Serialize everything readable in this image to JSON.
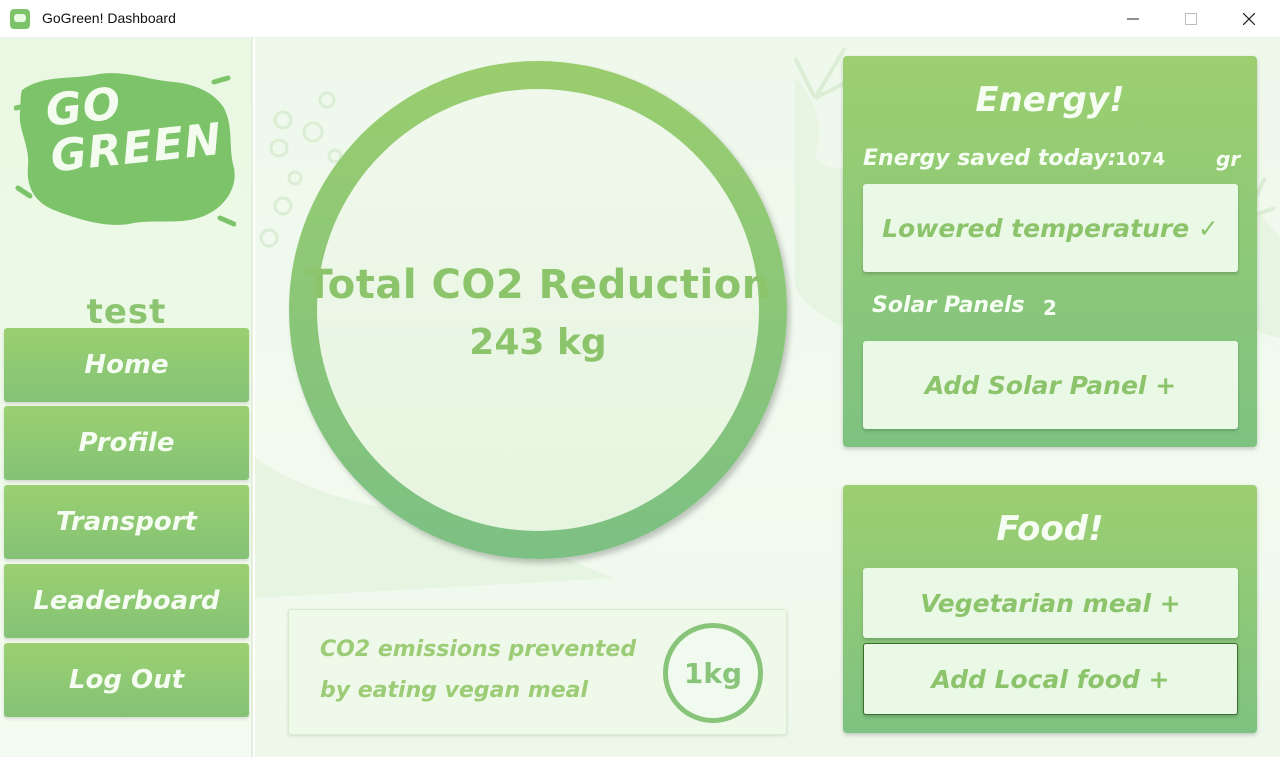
{
  "window": {
    "title": "GoGreen! Dashboard",
    "controls": {
      "minimize": "minimize-icon",
      "maximize": "maximize-icon",
      "close": "close-icon"
    }
  },
  "sidebar": {
    "logo_icon": "gogreen-logo",
    "username": "test",
    "nav": {
      "home": "Home",
      "profile": "Profile",
      "transport": "Transport",
      "leaderboard": "Leaderboard",
      "logout": "Log Out"
    }
  },
  "main": {
    "co2": {
      "title": "Total CO2 Reduction",
      "value": "243 kg"
    },
    "vegan_info": {
      "line1": "CO2 emissions prevented",
      "line2": "by eating vegan meal",
      "amount": "1kg"
    }
  },
  "energy": {
    "title": "Energy!",
    "saved_label": "Energy saved today:",
    "saved_value": "1074",
    "saved_unit": "gr",
    "lowered_temp_button": "Lowered temperature ✓",
    "solar_label": "Solar Panels",
    "solar_count": "2",
    "add_solar_button": "Add Solar Panel +"
  },
  "food": {
    "title": "Food!",
    "vegetarian_button": "Vegetarian meal +",
    "local_button": "Add Local food +"
  },
  "colors": {
    "accent_green": "#8cc46b",
    "panel_top": "#9ccf70",
    "panel_bottom": "#7ec281",
    "light_bg": "#eef8eb"
  }
}
